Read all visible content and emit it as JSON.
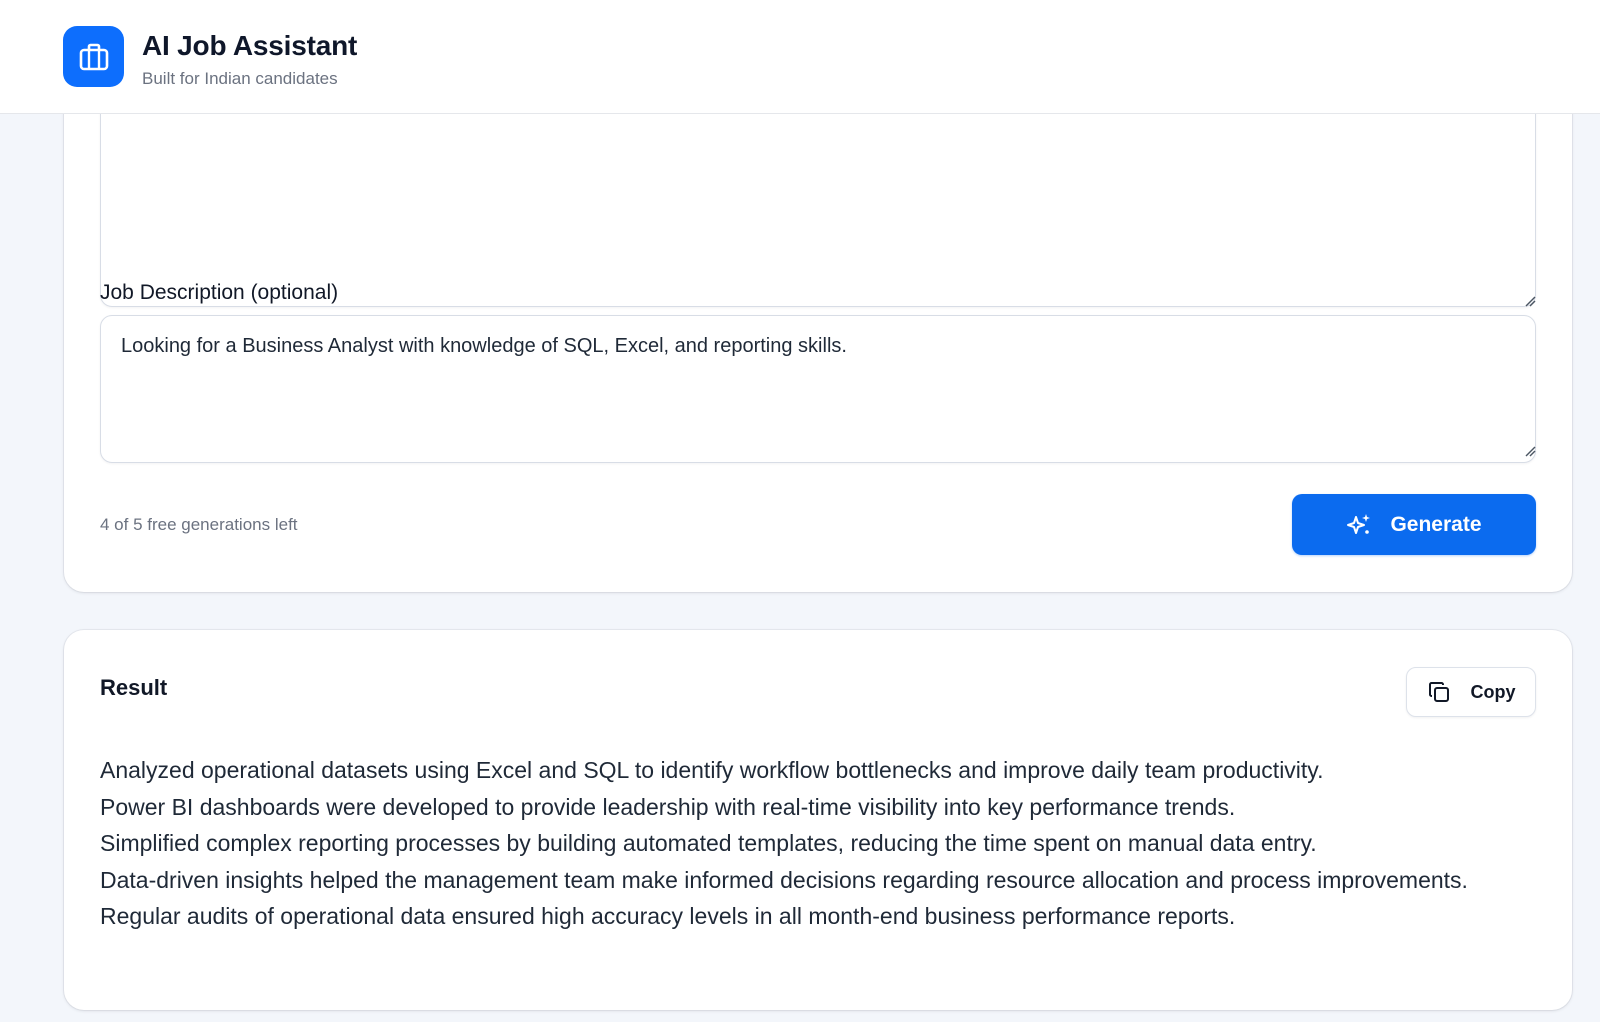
{
  "header": {
    "title": "AI Job Assistant",
    "subtitle": "Built for Indian candidates",
    "logo_icon": "briefcase-icon",
    "brand_color": "#0d6efd"
  },
  "form": {
    "upper_textarea_value": "",
    "job_description": {
      "label": "Job Description (optional)",
      "value": "Looking for a Business Analyst with knowledge of SQL, Excel, and reporting skills."
    },
    "credits_text": "4 of 5 free generations left",
    "generate_button": {
      "label": "Generate",
      "icon": "sparkles-icon"
    }
  },
  "result": {
    "title": "Result",
    "copy_button": {
      "label": "Copy",
      "icon": "copy-icon"
    },
    "lines": [
      "Analyzed operational datasets using Excel and SQL to identify workflow bottlenecks and improve daily team productivity.",
      "Power BI dashboards were developed to provide leadership with real-time visibility into key performance trends.",
      "Simplified complex reporting processes by building automated templates, reducing the time spent on manual data entry.",
      "Data-driven insights helped the management team make informed decisions regarding resource allocation and process improvements.",
      "Regular audits of operational data ensured high accuracy levels in all month-end business performance reports."
    ]
  }
}
